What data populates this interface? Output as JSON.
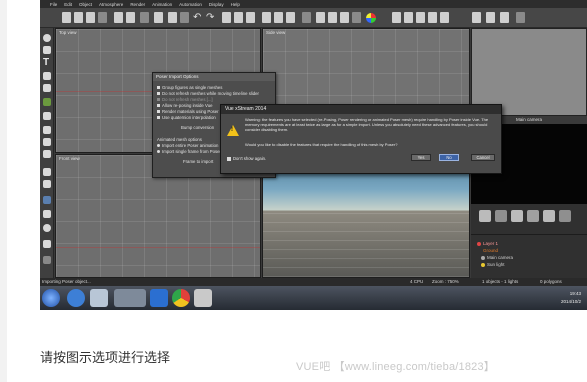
{
  "menu": [
    "File",
    "Edit",
    "Object",
    "Atmosphere",
    "Render",
    "Animation",
    "Automation",
    "Display",
    "Help"
  ],
  "toolbar": {
    "undo_icon": "undo-icon",
    "redo_icon": "redo-icon",
    "palette_icon": "color-palette-icon"
  },
  "viewports": {
    "top": "Top view",
    "side": "Side view",
    "front": "Front view"
  },
  "right_panel": {
    "camera_label": "Main camera",
    "world_items": [
      {
        "label": "Layer 1",
        "kind": "layer"
      },
      {
        "label": "Ground",
        "kind": "sub"
      },
      {
        "label": "Main camera",
        "kind": "item"
      },
      {
        "label": "Sun light",
        "kind": "item"
      }
    ]
  },
  "import_dialog": {
    "title": "Poser Import Options",
    "options": [
      {
        "label": "Group figures as single meshes",
        "state": "checked"
      },
      {
        "label": "Do not refresh meshes while moving timeline slider",
        "state": "checked"
      },
      {
        "label": "Do not refresh meshes [...]",
        "state": "disabled"
      },
      {
        "label": "Allow re-posing inside Vue",
        "state": "checked"
      },
      {
        "label": "Render materials using Poser",
        "state": "checked"
      },
      {
        "label": "Use quaternion interpolation",
        "state": "checked"
      }
    ],
    "bump_label": "Bump conversion",
    "anim_header": "Animated mesh options",
    "anim_options": [
      "Import entire Poser animation",
      "Import single frame from Poser"
    ],
    "frame_label": "Frame to import",
    "close_label": "×"
  },
  "xstream_dialog": {
    "title": "Vue xStream 2014",
    "message": "Warning: the features you have selected (re-Posing, Poser rendering or animated Poser mesh) require handling by Poser inside Vue. The memory requirements are at least twice as large as for a simple import. Unless you absolutely need these advanced features, you should consider disabling them.",
    "question": "Would you like to disable the features that require the handling of this mesh by Poser?",
    "dont_show": "Don't show again.",
    "yes": "Yes",
    "no": "No",
    "cancel": "Cancel"
  },
  "status": {
    "left": "Importing Poser object...",
    "cpu": "4 CPU",
    "zoom": "Zoom : 750%",
    "objects": "1 objects - 1 lights",
    "fps": "0 polygons"
  },
  "taskbar": {
    "time": "19:43",
    "date": "2014/10/2"
  },
  "caption": "请按图示选项进行选择",
  "watermark": "VUE吧 【www.lineeg.com/tieba/1823】"
}
